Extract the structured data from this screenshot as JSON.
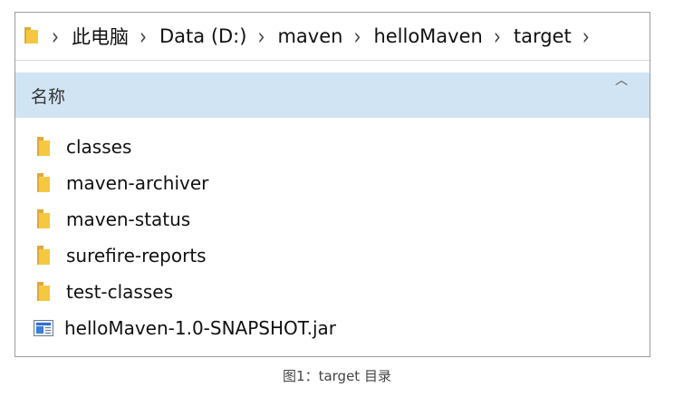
{
  "breadcrumb": [
    "此电脑",
    "Data (D:)",
    "maven",
    "helloMaven",
    "target"
  ],
  "header": {
    "column_name": "名称"
  },
  "files": [
    {
      "name": "classes",
      "type": "folder"
    },
    {
      "name": "maven-archiver",
      "type": "folder"
    },
    {
      "name": "maven-status",
      "type": "folder"
    },
    {
      "name": "surefire-reports",
      "type": "folder"
    },
    {
      "name": "test-classes",
      "type": "folder"
    },
    {
      "name": "helloMaven-1.0-SNAPSHOT.jar",
      "type": "jar-file"
    }
  ],
  "caption": "图1：target 目录",
  "colors": {
    "header_bg": "#d0e4f4",
    "folder_yellow": "#f5c842",
    "border": "#9c9c9c"
  }
}
